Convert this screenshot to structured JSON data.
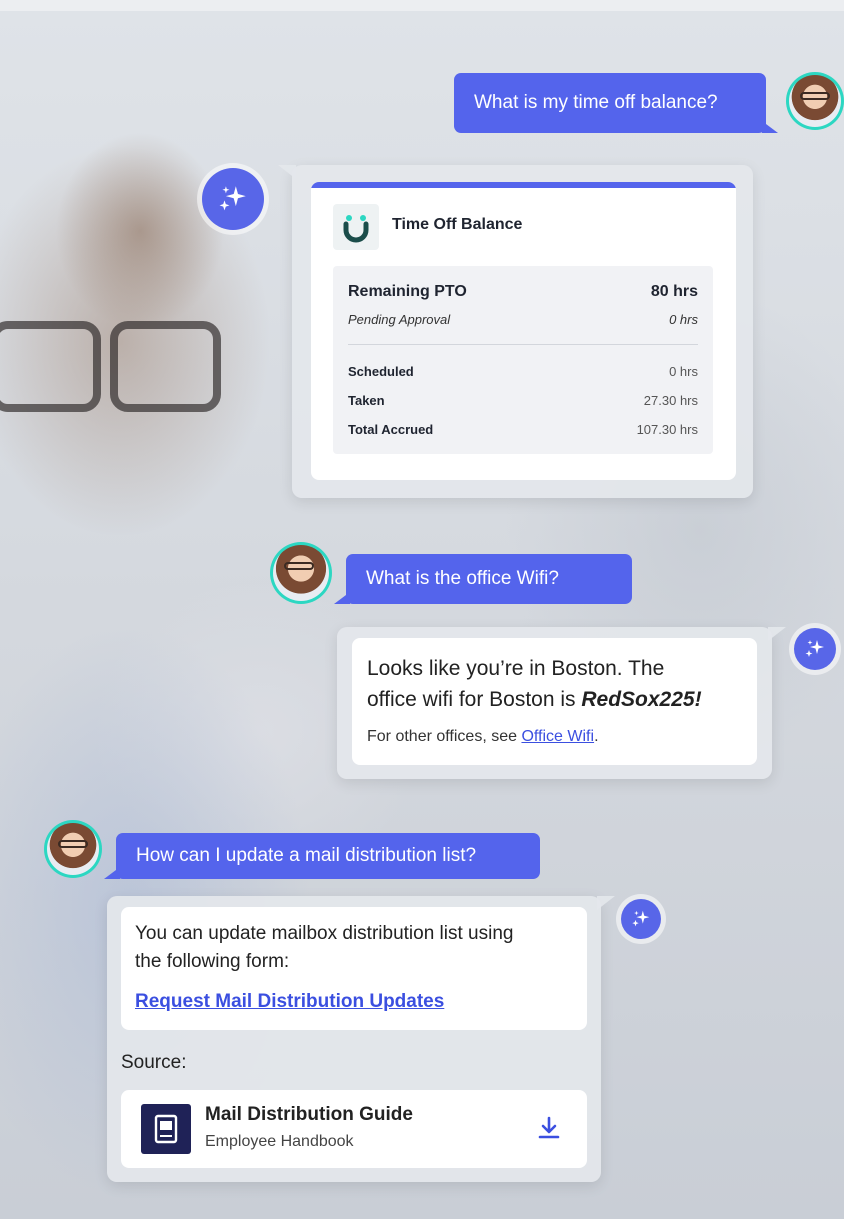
{
  "chat": [
    {
      "user_question": "What is my time off balance?",
      "card": {
        "title": "Time Off Balance",
        "primary": {
          "label": "Remaining PTO",
          "value": "80 hrs"
        },
        "pending": {
          "label": "Pending Approval",
          "value": "0 hrs"
        },
        "rows": [
          {
            "label": "Scheduled",
            "value": "0 hrs"
          },
          {
            "label": "Taken",
            "value": "27.30 hrs"
          },
          {
            "label": "Total Accrued",
            "value": "107.30 hrs"
          }
        ]
      }
    },
    {
      "user_question": "What is the office Wifi?",
      "answer_line1": "Looks like you’re in Boston. The",
      "answer_line2_prefix": "office wifi for Boston is ",
      "answer_password": "RedSox225!",
      "other_prefix": "For other offices, see ",
      "other_link": "Office Wifi",
      "other_suffix": "."
    },
    {
      "user_question": "How can I update a mail distribution list?",
      "answer_line1": "You can update mailbox distribution list using",
      "answer_line2": "the following form:",
      "form_link": "Request Mail Distribution Updates",
      "source_label": "Source:",
      "source": {
        "title": "Mail Distribution Guide",
        "subtitle": "Employee Handbook"
      }
    }
  ],
  "icons": {
    "ai": "sparkle-icon",
    "download": "download-icon",
    "document": "book-icon",
    "logo": "smile-logo-icon"
  },
  "colors": {
    "accent": "#5464ec",
    "avatar_ring": "#2cd7c2",
    "link": "#3b4fe0",
    "doc_icon": "#1f2257"
  }
}
